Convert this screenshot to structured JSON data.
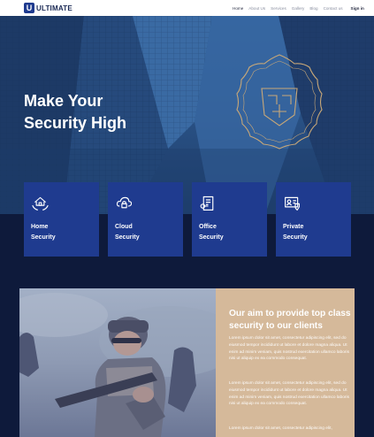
{
  "brand": {
    "logo_letter": "U",
    "name": "ULTIMATE"
  },
  "nav": {
    "links": [
      "Home",
      "About Us",
      "Services",
      "Gallery",
      "Blog",
      "Contact us"
    ],
    "signin": "Sign in"
  },
  "hero": {
    "title_line1": "Make Your",
    "title_line2": "Security High"
  },
  "services": [
    {
      "line1": "Home",
      "line2": "Security",
      "icon": "house-hands-icon"
    },
    {
      "line1": "Cloud",
      "line2": "Security",
      "icon": "cloud-lock-icon"
    },
    {
      "line1": "Office",
      "line2": "Security",
      "icon": "office-key-icon"
    },
    {
      "line1": "Private",
      "line2": "Security",
      "icon": "id-card-shield-icon"
    }
  ],
  "about": {
    "title": "Our aim to provide top class security to our clients",
    "paragraphs": [
      "Lorem ipsum dolor sit amet, consectetur adipiscing elit, sed do eiusmod tempor incididunt ut labore et dolore magna aliqua. Ut enim ad minim veniam, quis nostrud exercitation ullamco laboris nisi ut aliquip ex ea commodo consequat.",
      "Lorem ipsum dolor sit amet, consectetur adipiscing elit, sed do eiusmod tempor incididunt ut labore et dolore magna aliqua. Ut enim ad minim veniam, quis nostrud exercitation ullamco laboris nisi ut aliquip ex ea commodo consequat.",
      "Lorem ipsum dolor sit amet, consectetur adipiscing elit,"
    ]
  },
  "colors": {
    "accent": "#1f3b8f",
    "dark_bg": "#0e1a3b",
    "sand": "#d5b99a",
    "emblem": "#c9a878"
  }
}
